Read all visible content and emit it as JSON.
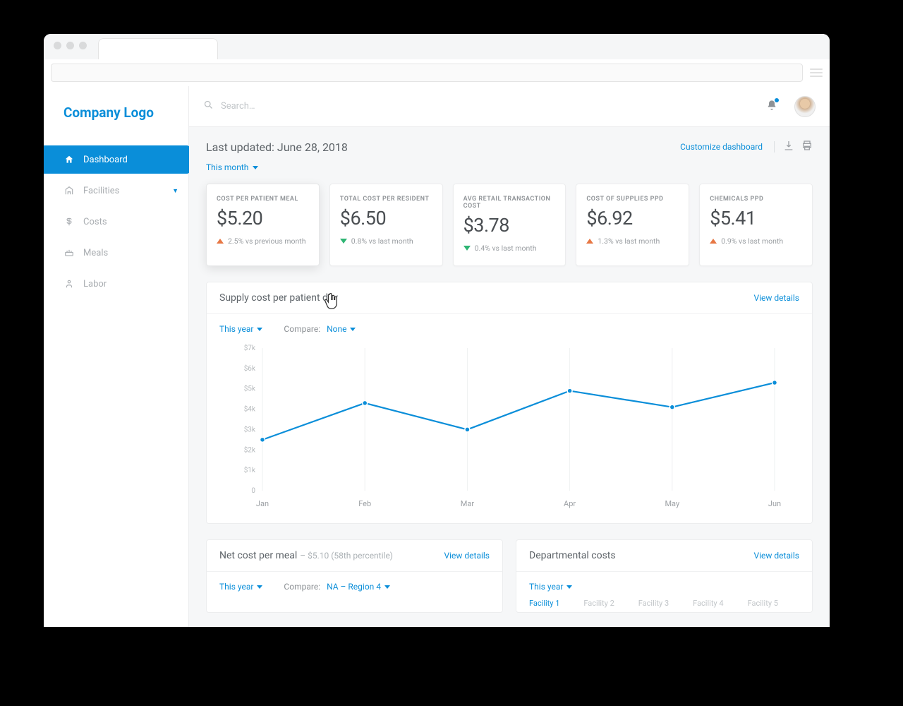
{
  "browser": {},
  "logo_text": "Company Logo",
  "nav": {
    "items": [
      {
        "label": "Dashboard",
        "icon": "home-icon"
      },
      {
        "label": "Facilities",
        "icon": "building-icon"
      },
      {
        "label": "Costs",
        "icon": "dollar-icon"
      },
      {
        "label": "Meals",
        "icon": "meals-icon"
      },
      {
        "label": "Labor",
        "icon": "person-icon"
      }
    ]
  },
  "topbar": {
    "search_placeholder": "Search…"
  },
  "header": {
    "last_updated": "Last updated: June 28, 2018",
    "period": "This month",
    "customize": "Customize dashboard"
  },
  "kpis": [
    {
      "label": "COST PER PATIENT MEAL",
      "value": "$5.20",
      "dir": "up",
      "delta": "2.5% vs previous month"
    },
    {
      "label": "TOTAL COST PER RESIDENT",
      "value": "$6.50",
      "dir": "down",
      "delta": "0.8% vs last month"
    },
    {
      "label": "AVG RETAIL TRANSACTION COST",
      "value": "$3.78",
      "dir": "down",
      "delta": "0.4% vs last month"
    },
    {
      "label": "COST OF SUPPLIES PPD",
      "value": "$6.92",
      "dir": "up",
      "delta": "1.3% vs last month"
    },
    {
      "label": "CHEMICALS PPD",
      "value": "$5.41",
      "dir": "up",
      "delta": "0.9% vs last month"
    }
  ],
  "supply_panel": {
    "title": "Supply cost per patient day",
    "view_details": "View details",
    "filter_period_label": "This year",
    "compare_label": "Compare:",
    "compare_value": "None"
  },
  "chart_data": {
    "type": "line",
    "title": "Supply cost per patient day",
    "xlabel": "",
    "ylabel": "",
    "categories": [
      "Jan",
      "Feb",
      "Mar",
      "Apr",
      "May",
      "Jun"
    ],
    "x": [
      "Jan",
      "Feb",
      "Mar",
      "Apr",
      "May",
      "Jun"
    ],
    "values": [
      2500,
      4300,
      3000,
      4900,
      4100,
      5300
    ],
    "y_ticks": [
      0,
      1000,
      2000,
      3000,
      4000,
      5000,
      6000,
      7000
    ],
    "y_tick_labels": [
      "0",
      "$1k",
      "$2k",
      "$3k",
      "$4k",
      "$5k",
      "$6k",
      "$7k"
    ],
    "ylim": [
      0,
      7000
    ],
    "series": [
      {
        "name": "Supply cost",
        "values": [
          2500,
          4300,
          3000,
          4900,
          4100,
          5300
        ]
      }
    ],
    "grid": "vertical"
  },
  "net_cost_panel": {
    "title": "Net cost per meal",
    "subtitle": "– $5.10 (58th percentile)",
    "view_details": "View details",
    "filter_period_label": "This year",
    "compare_label": "Compare:",
    "compare_value": "NA – Region 4"
  },
  "dept_panel": {
    "title": "Departmental costs",
    "view_details": "View details",
    "filter_period_label": "This year",
    "facilities": [
      "Facility 1",
      "Facility 2",
      "Facility 3",
      "Facility 4",
      "Facility 5"
    ]
  },
  "colors": {
    "accent": "#0a8ed9",
    "up": "#e77744",
    "down": "#2fb574",
    "text_light": "#9ca0a4"
  }
}
